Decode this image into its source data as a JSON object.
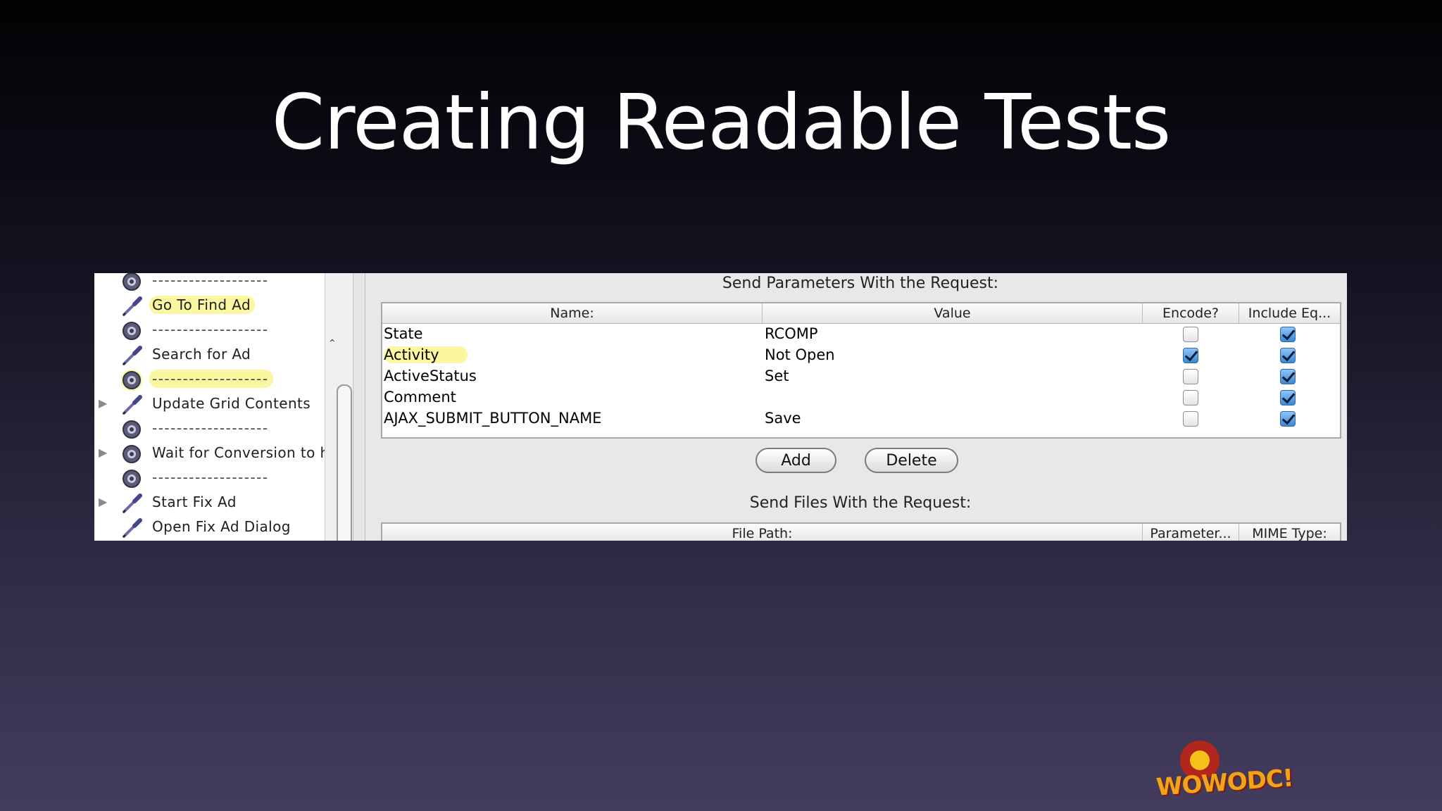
{
  "slide": {
    "title": "Creating Readable Tests"
  },
  "tree": {
    "items": [
      {
        "label": "-------------------",
        "icon": "gear-icon",
        "expander": false,
        "highlight": false,
        "separator": true
      },
      {
        "label": "Go To Find Ad",
        "icon": "dropper-icon",
        "expander": false,
        "highlight": true,
        "separator": false
      },
      {
        "label": "-------------------",
        "icon": "gear-icon",
        "expander": false,
        "highlight": false,
        "separator": true
      },
      {
        "label": "Search for Ad",
        "icon": "dropper-icon",
        "expander": false,
        "highlight": false,
        "separator": false
      },
      {
        "label": "-------------------",
        "icon": "gear-icon",
        "expander": false,
        "highlight": true,
        "separator": true
      },
      {
        "label": "Update Grid Contents",
        "icon": "dropper-icon",
        "expander": true,
        "highlight": false,
        "separator": false
      },
      {
        "label": "-------------------",
        "icon": "gear-icon",
        "expander": false,
        "highlight": false,
        "separator": true
      },
      {
        "label": "Wait for Conversion to ha",
        "icon": "gear-icon",
        "expander": true,
        "highlight": false,
        "separator": false
      },
      {
        "label": "-------------------",
        "icon": "gear-icon",
        "expander": false,
        "highlight": false,
        "separator": true
      },
      {
        "label": "Start Fix Ad",
        "icon": "dropper-icon",
        "expander": true,
        "highlight": false,
        "separator": false
      },
      {
        "label": "Open Fix Ad Dialog",
        "icon": "dropper-icon",
        "expander": false,
        "highlight": false,
        "separator": false
      }
    ]
  },
  "params": {
    "title": "Send Parameters With the Request:",
    "columns": [
      "Name:",
      "Value",
      "Encode?",
      "Include Eq..."
    ],
    "rows": [
      {
        "name": "State",
        "value": "RCOMP",
        "encode": false,
        "include_equals": true,
        "highlight": false
      },
      {
        "name": "Activity",
        "value": "Not Open",
        "encode": true,
        "include_equals": true,
        "highlight": true
      },
      {
        "name": "ActiveStatus",
        "value": "Set",
        "encode": false,
        "include_equals": true,
        "highlight": false
      },
      {
        "name": "Comment",
        "value": "",
        "encode": false,
        "include_equals": true,
        "highlight": false
      },
      {
        "name": "AJAX_SUBMIT_BUTTON_NAME",
        "value": "Save",
        "encode": false,
        "include_equals": true,
        "highlight": false
      }
    ],
    "add_label": "Add",
    "delete_label": "Delete"
  },
  "files": {
    "title": "Send Files With the Request:",
    "columns": [
      "File Path:",
      "Parameter...",
      "MIME Type:"
    ]
  },
  "logo": {
    "text": "WOWODC!"
  },
  "colors": {
    "highlight": "#fbf7a0",
    "checkbox_on": "#3b86d6"
  }
}
